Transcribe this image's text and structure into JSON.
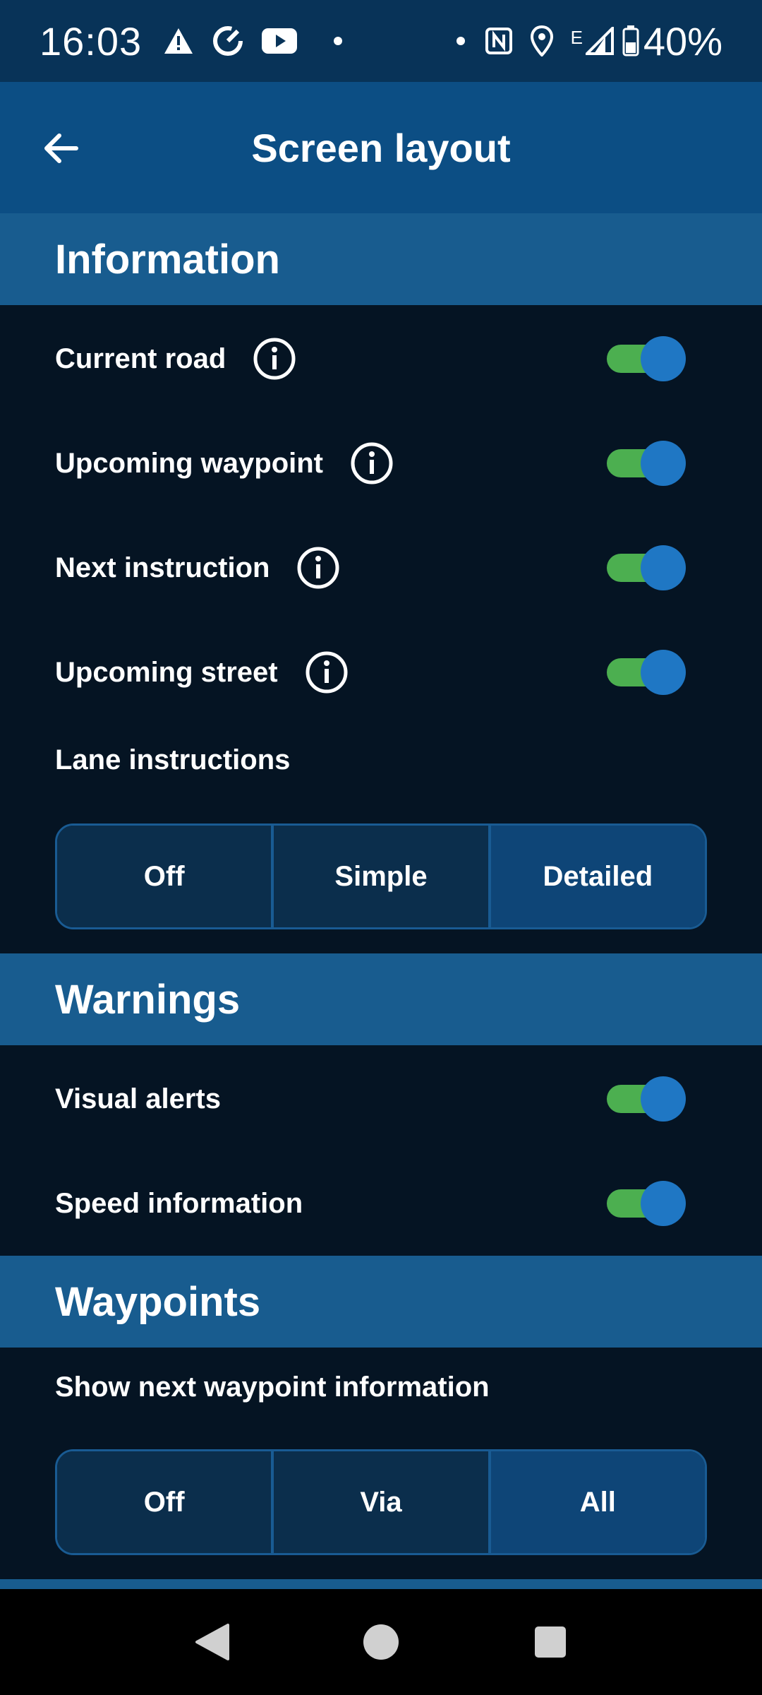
{
  "status_bar": {
    "time": "16:03",
    "network": "E",
    "battery": "40%"
  },
  "app_bar": {
    "title": "Screen layout"
  },
  "sections": {
    "information": {
      "title": "Information",
      "toggles": [
        {
          "label": "Current road",
          "on": true,
          "has_info": true
        },
        {
          "label": "Upcoming waypoint",
          "on": true,
          "has_info": true
        },
        {
          "label": "Next instruction",
          "on": true,
          "has_info": true
        },
        {
          "label": "Upcoming street",
          "on": true,
          "has_info": true
        }
      ],
      "lane_label": "Lane instructions",
      "lane_options": [
        "Off",
        "Simple",
        "Detailed"
      ],
      "lane_selected": "Detailed"
    },
    "warnings": {
      "title": "Warnings",
      "toggles": [
        {
          "label": "Visual alerts",
          "on": true
        },
        {
          "label": "Speed information",
          "on": true
        }
      ]
    },
    "waypoints": {
      "title": "Waypoints",
      "show_label": "Show next waypoint information",
      "options": [
        "Off",
        "Via",
        "All"
      ],
      "selected": "All"
    }
  },
  "colors": {
    "background": "#051423",
    "status_bar": "#083358",
    "app_bar": "#0c4e84",
    "section_header": "#185c8f",
    "toggle_track": "#4caf50",
    "toggle_thumb": "#1f77c4",
    "segment_selected": "#0e4577",
    "segment": "#0b2e4c"
  }
}
